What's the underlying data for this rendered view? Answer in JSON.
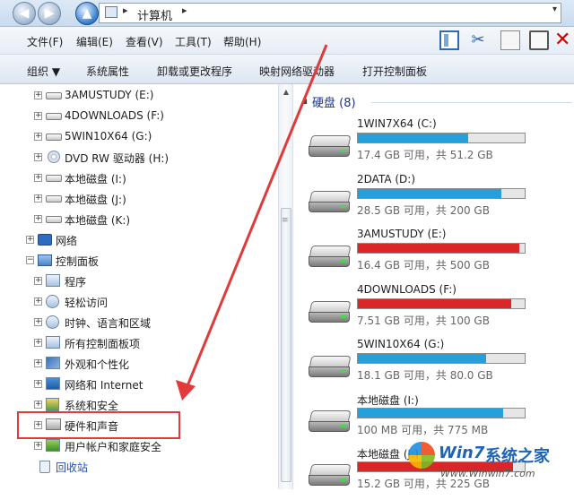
{
  "address_bar": {
    "path": "计算机",
    "separator": "▸",
    "dropdown": "▾",
    "back_glyph": "◀",
    "forward_glyph": "▶",
    "up_glyph": "▲"
  },
  "menu": {
    "file": "文件(F)",
    "edit": "编辑(E)",
    "view": "查看(V)",
    "tools": "工具(T)",
    "help": "帮助(H)"
  },
  "toolbar_icons": [
    "preview-pane-icon",
    "cut-icon",
    "copy-icon",
    "paste-icon",
    "delete-icon"
  ],
  "toolbar_glyphs": {
    "cut": "✂",
    "delete": "✕"
  },
  "command_bar": {
    "organize": "组织 ▼",
    "system_properties": "系统属性",
    "uninstall": "卸载或更改程序",
    "map_drive": "映射网络驱动器",
    "open_control_panel": "打开控制面板"
  },
  "tree": {
    "expand_glyph": "+",
    "collapse_glyph": "−",
    "drives": [
      {
        "label": "3AMUSTUDY (E:)",
        "icon": "drive-icon"
      },
      {
        "label": "4DOWNLOADS (F:)",
        "icon": "drive-icon"
      },
      {
        "label": "5WIN10X64 (G:)",
        "icon": "drive-icon"
      },
      {
        "label": "DVD RW 驱动器 (H:)",
        "icon": "dvd-icon"
      },
      {
        "label": "本地磁盘 (I:)",
        "icon": "drive-icon"
      },
      {
        "label": "本地磁盘 (J:)",
        "icon": "drive-icon"
      },
      {
        "label": "本地磁盘 (K:)",
        "icon": "drive-icon"
      }
    ],
    "network": "网络",
    "control_panel": "控制面板",
    "cp_children": [
      {
        "label": "程序",
        "icon": "programs-icon"
      },
      {
        "label": "轻松访问",
        "icon": "ease-of-access-icon"
      },
      {
        "label": "时钟、语言和区域",
        "icon": "clock-language-icon"
      },
      {
        "label": "所有控制面板项",
        "icon": "all-items-icon"
      },
      {
        "label": "外观和个性化",
        "icon": "appearance-icon"
      },
      {
        "label": "网络和 Internet",
        "icon": "network-internet-icon"
      },
      {
        "label": "系统和安全",
        "icon": "system-security-icon"
      },
      {
        "label": "硬件和声音",
        "icon": "hardware-sound-icon"
      },
      {
        "label": "用户帐户和家庭安全",
        "icon": "user-accounts-icon"
      }
    ],
    "recycle_bin": "回收站"
  },
  "scrollbar": {
    "up_glyph": "▲",
    "grip_glyph": "≡"
  },
  "content": {
    "group_title": "硬盘 (8)",
    "group_arrow": "◢",
    "drives": [
      {
        "name": "1WIN7X64 (C:)",
        "free_text": "17.4 GB 可用，共 51.2 GB",
        "used_fraction": 0.66,
        "bar_color": "#26a0da"
      },
      {
        "name": "2DATA (D:)",
        "free_text": "28.5 GB 可用，共 200 GB",
        "used_fraction": 0.86,
        "bar_color": "#26a0da"
      },
      {
        "name": "3AMUSTUDY (E:)",
        "free_text": "16.4 GB 可用，共 500 GB",
        "used_fraction": 0.97,
        "bar_color": "#da2626"
      },
      {
        "name": "4DOWNLOADS (F:)",
        "free_text": "7.51 GB 可用，共 100 GB",
        "used_fraction": 0.92,
        "bar_color": "#da2626"
      },
      {
        "name": "5WIN10X64 (G:)",
        "free_text": "18.1 GB 可用，共 80.0 GB",
        "used_fraction": 0.77,
        "bar_color": "#26a0da"
      },
      {
        "name": "本地磁盘 (I:)",
        "free_text": "100 MB 可用，共 775 MB",
        "used_fraction": 0.87,
        "bar_color": "#26a0da"
      },
      {
        "name": "本地磁盘 (J:)",
        "free_text": "15.2 GB 可用，共 225 GB",
        "used_fraction": 0.93,
        "bar_color": "#da2626"
      }
    ]
  },
  "watermark": {
    "brand_a": "Win7",
    "brand_b": "系统之家",
    "url": "Www.Winwin7.com"
  },
  "annotation_color": "#e03a3a"
}
